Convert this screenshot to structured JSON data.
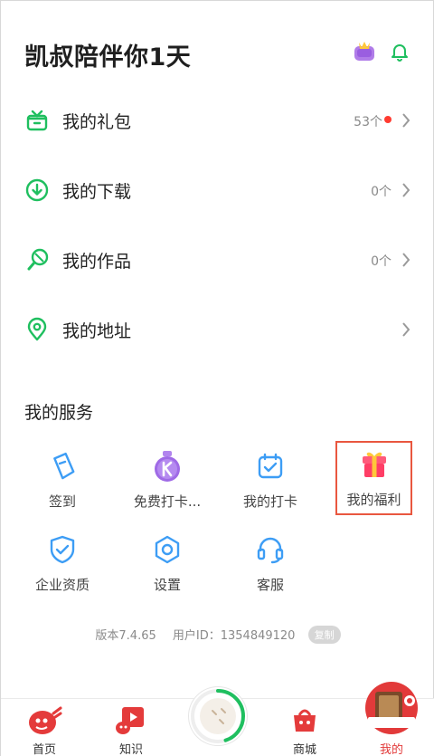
{
  "header": {
    "greeting": "凯叔陪伴你1天"
  },
  "menu": [
    {
      "label": "我的礼包",
      "count": "53个",
      "has_dot": true,
      "icon": "gift-box-icon"
    },
    {
      "label": "我的下载",
      "count": "0个",
      "has_dot": false,
      "icon": "download-icon"
    },
    {
      "label": "我的作品",
      "count": "0个",
      "has_dot": false,
      "icon": "microphone-icon"
    },
    {
      "label": "我的地址",
      "count": "",
      "has_dot": false,
      "icon": "location-pin-icon"
    }
  ],
  "services": {
    "title": "我的服务",
    "items": [
      {
        "label": "签到",
        "icon": "sign-in-icon"
      },
      {
        "label": "免费打卡...",
        "icon": "medal-icon"
      },
      {
        "label": "我的打卡",
        "icon": "calendar-check-icon"
      },
      {
        "label": "我的福利",
        "icon": "gift-icon",
        "highlighted": true
      },
      {
        "label": "企业资质",
        "icon": "shield-check-icon"
      },
      {
        "label": "设置",
        "icon": "settings-icon"
      },
      {
        "label": "客服",
        "icon": "headset-icon"
      }
    ]
  },
  "footer": {
    "version": "版本7.4.65",
    "user_id": "用户ID：1354849120",
    "copy_label": "复制"
  },
  "tabbar": {
    "tabs": [
      {
        "label": "首页",
        "active": false
      },
      {
        "label": "知识",
        "active": false
      },
      {
        "label": "商城",
        "active": false
      },
      {
        "label": "我的",
        "active": true
      }
    ],
    "center_progress": 0.45
  },
  "colors": {
    "green": "#1fbf5f",
    "blue": "#3d9df5",
    "red_accent": "#e23a3a",
    "highlight_border": "#e9573f"
  }
}
